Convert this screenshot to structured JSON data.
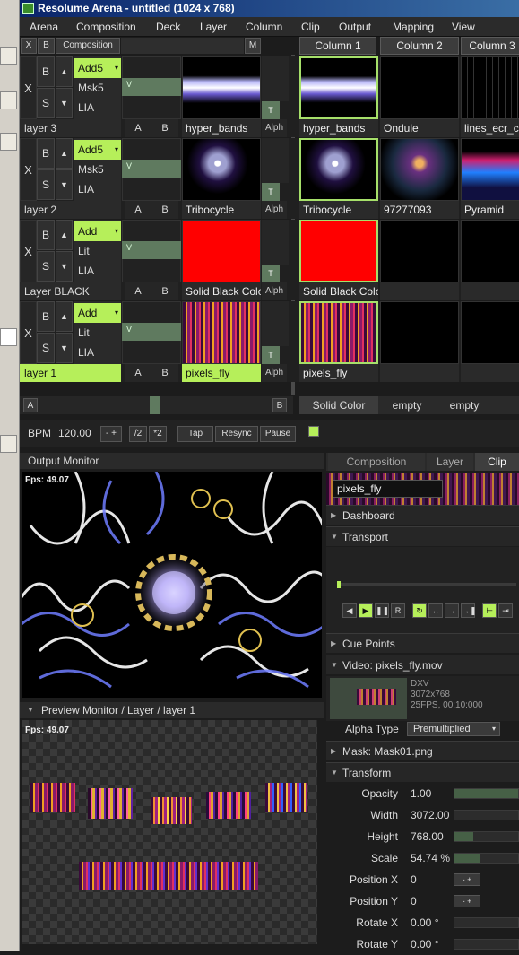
{
  "window": {
    "title": "Resolume Arena - untitled (1024 x 768)"
  },
  "menu": [
    "Arena",
    "Composition",
    "Deck",
    "Layer",
    "Column",
    "Clip",
    "Output",
    "Mapping",
    "View"
  ],
  "comp_bar": {
    "x": "X",
    "b": "B",
    "label": "Composition",
    "m": "M"
  },
  "columns": [
    "Column 1",
    "Column 2",
    "Column 3"
  ],
  "layers": [
    {
      "name": "layer 3",
      "blend": "Add5",
      "opts": [
        "Msk5",
        "LIA"
      ],
      "v": "V",
      "clip": "hyper_bands",
      "alph": "Alph",
      "t": "T",
      "cells": [
        "hyper_bands",
        "Ondule",
        "lines_ecr_cen"
      ],
      "active": false
    },
    {
      "name": "layer 2",
      "blend": "Add5",
      "opts": [
        "Msk5",
        "LIA"
      ],
      "v": "V",
      "clip": "Tribocycle",
      "alph": "Alph",
      "t": "T",
      "cells": [
        "Tribocycle",
        "97277093",
        "Pyramid"
      ],
      "active": false
    },
    {
      "name": "Layer BLACK",
      "blend": "Add",
      "opts": [
        "Lit",
        "LIA"
      ],
      "v": "V",
      "clip": "Solid Black Color",
      "alph": "Alph",
      "t": "T",
      "cells": [
        "Solid Black Color",
        "",
        ""
      ],
      "active": false
    },
    {
      "name": "layer 1",
      "blend": "Add",
      "opts": [
        "Lit",
        "LIA"
      ],
      "v": "V",
      "clip": "pixels_fly",
      "alph": "Alph",
      "t": "T",
      "cells": [
        "pixels_fly",
        "",
        ""
      ],
      "active": true
    }
  ],
  "layer_btn": {
    "x": "X",
    "b": "B",
    "s": "S",
    "a": "A",
    "bb": "B",
    "up": "▲",
    "down": "▼"
  },
  "crossfader": {
    "a": "A",
    "b": "B"
  },
  "deck_tabs": [
    "Solid Color",
    "empty",
    "empty"
  ],
  "bpm": {
    "label": "BPM",
    "value": "120.00",
    "minus": "-",
    "plus": "+",
    "half": "/2",
    "double": "*2",
    "tap": "Tap",
    "resync": "Resync",
    "pause": "Pause"
  },
  "output_monitor": {
    "title": "Output Monitor",
    "fps": "Fps: 49.07"
  },
  "preview_monitor": {
    "title": "Preview Monitor / Layer / layer 1",
    "fps": "Fps: 49.07"
  },
  "tabs": [
    "Composition",
    "Layer",
    "Clip"
  ],
  "clip_panel": {
    "clip_name": "pixels_fly",
    "sections": {
      "dashboard": "Dashboard",
      "transport": "Transport",
      "cue_points": "Cue Points",
      "video": "Video: pixels_fly.mov",
      "mask": "Mask: Mask01.png",
      "transform": "Transform"
    },
    "video_info": [
      "DXV",
      "3072x768",
      "25FPS, 00:10:000"
    ],
    "alpha_type_label": "Alpha Type",
    "alpha_type_value": "Premultiplied",
    "transport_buttons": [
      "◀",
      "▶",
      "❚❚",
      "R",
      "↻",
      "↔",
      "→",
      "→❚"
    ],
    "props": [
      {
        "label": "Opacity",
        "value": "1.00",
        "fill": 1.0,
        "kind": "bar"
      },
      {
        "label": "Width",
        "value": "3072.00",
        "fill": 0,
        "kind": "bar"
      },
      {
        "label": "Height",
        "value": "768.00",
        "fill": 0.3,
        "kind": "bar"
      },
      {
        "label": "Scale",
        "value": "54.74 %",
        "fill": 0.4,
        "kind": "bar"
      },
      {
        "label": "Position X",
        "value": "0",
        "kind": "pm"
      },
      {
        "label": "Position Y",
        "value": "0",
        "kind": "pm"
      },
      {
        "label": "Rotate X",
        "value": "0.00 °",
        "fill": 0,
        "kind": "bar"
      },
      {
        "label": "Rotate Y",
        "value": "0.00 °",
        "fill": 0,
        "kind": "bar"
      }
    ]
  },
  "colors": {
    "accent": "#b6ef5a",
    "title_bar": "#0a246a",
    "red_clip": "#ff0000"
  }
}
